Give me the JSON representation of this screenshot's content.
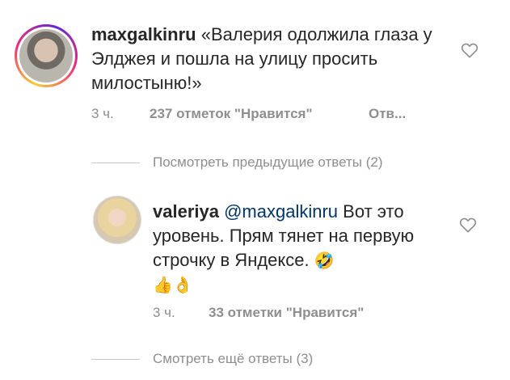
{
  "comment": {
    "username": "maxgalkinru",
    "text": "«Валерия одолжила глаза у Элджея и пошла на улицу просить милостыню!»",
    "time": "3 ч.",
    "likes": "237 отметок \"Нравится\"",
    "reply_label": "Отв...",
    "like_icon": "heart-outline-icon"
  },
  "view_previous_replies": "Посмотреть предыдущие ответы (2)",
  "reply": {
    "username": "valeriya",
    "mention": "@maxgalkinru",
    "text": "Вот это уровень. Прям тянет на первую строчку в Яндексе.",
    "emoji_1": "🤣",
    "emoji_2": "👍",
    "emoji_3": "👌",
    "time": "3 ч.",
    "likes": "33 отметки \"Нравится\"",
    "like_icon": "heart-outline-icon"
  },
  "view_more_replies": "Смотреть ещё ответы (3)",
  "colors": {
    "text": "#262626",
    "secondary": "#8e8e8e",
    "mention": "#003569",
    "story_ring": [
      "#f9ce34",
      "#ee2a7b",
      "#6228d7"
    ]
  }
}
